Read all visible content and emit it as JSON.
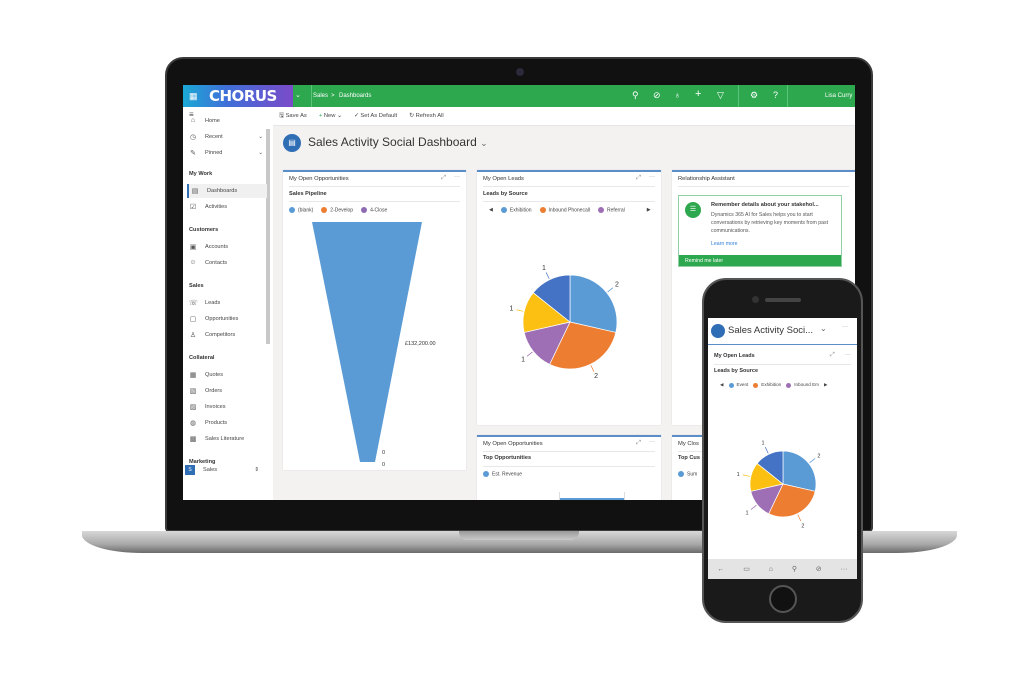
{
  "brand": {
    "logo": "CHORUS",
    "green": "#2ea84f",
    "accent": "#2f6db5"
  },
  "topbar": {
    "breadcrumb": [
      "Sales",
      "Dashboards"
    ],
    "separator": ">",
    "user": "Lisa Curry",
    "icons": [
      "search-icon",
      "task-icon",
      "lightbulb-icon",
      "plus-icon",
      "filter-icon",
      "gear-icon",
      "help-icon"
    ]
  },
  "sidebar": {
    "top": [
      {
        "label": "Home",
        "icon": "⌂"
      },
      {
        "label": "Recent",
        "icon": "◷"
      },
      {
        "label": "Pinned",
        "icon": "✎"
      }
    ],
    "sections": [
      {
        "title": "My Work",
        "items": [
          {
            "label": "Dashboards",
            "icon": "▤",
            "active": true
          },
          {
            "label": "Activities",
            "icon": "☑"
          }
        ]
      },
      {
        "title": "Customers",
        "items": [
          {
            "label": "Accounts",
            "icon": "▣"
          },
          {
            "label": "Contacts",
            "icon": "☺"
          }
        ]
      },
      {
        "title": "Sales",
        "items": [
          {
            "label": "Leads",
            "icon": "☏"
          },
          {
            "label": "Opportunities",
            "icon": "▢"
          },
          {
            "label": "Competitors",
            "icon": "♙"
          }
        ]
      },
      {
        "title": "Collateral",
        "items": [
          {
            "label": "Quotes",
            "icon": "▦"
          },
          {
            "label": "Orders",
            "icon": "▧"
          },
          {
            "label": "Invoices",
            "icon": "▨"
          },
          {
            "label": "Products",
            "icon": "◍"
          },
          {
            "label": "Sales Literature",
            "icon": "▩"
          }
        ]
      },
      {
        "title": "Marketing",
        "items": []
      }
    ],
    "area": {
      "badge": "S",
      "label": "Sales"
    }
  },
  "commands": {
    "save_as": "Save As",
    "new": "New",
    "set_default": "Set As Default",
    "refresh": "Refresh All"
  },
  "dashboard_title": "Sales Activity Social Dashboard",
  "cards": {
    "opps": {
      "title": "My Open Opportunities",
      "subtitle": "Sales Pipeline",
      "legend": [
        {
          "label": "(blank)",
          "color": "#5b9bd5"
        },
        {
          "label": "2-Develop",
          "color": "#ed7d31"
        },
        {
          "label": "4-Close",
          "color": "#8e6bb0"
        }
      ]
    },
    "leads": {
      "title": "My Open Leads",
      "subtitle": "Leads by Source",
      "legend": [
        {
          "label": "Exhibition",
          "color": "#5b9bd5"
        },
        {
          "label": "Inbound Phonecall",
          "color": "#ed7d31"
        },
        {
          "label": "Referral",
          "color": "#9e6fb4"
        }
      ]
    },
    "assistant": {
      "title": "Relationship Assistant",
      "heading": "Remember details about your stakehol...",
      "body": "Dynamics 365 AI for Sales helps you to start conversations by retrieving key moments from past communications.",
      "link": "Learn more",
      "action": "Remind me later"
    },
    "top_opps": {
      "title": "My Open Opportunities",
      "subtitle": "Top Opportunities",
      "legend": [
        {
          "label": "Est. Revenue",
          "color": "#5b9bd5"
        }
      ]
    },
    "closed": {
      "title": "My Clos",
      "subtitle": "Top Cus",
      "legend": [
        {
          "label": "Sum",
          "color": "#5b9bd5"
        }
      ]
    }
  },
  "chart_data": [
    {
      "type": "funnel",
      "title": "Sales Pipeline",
      "categories": [
        "(blank)",
        "2-Develop",
        "4-Close"
      ],
      "values": [
        132200,
        0,
        0
      ],
      "labels": [
        "£132,200.00",
        "0",
        "0"
      ]
    },
    {
      "type": "pie",
      "title": "Leads by Source",
      "values": [
        2,
        2,
        1,
        1,
        1
      ],
      "colors": [
        "#5b9bd5",
        "#ed7d31",
        "#9e6fb4",
        "#fcc012",
        "#4472c4"
      ],
      "labels": [
        "2",
        "2",
        "1",
        "1",
        "1"
      ]
    }
  ],
  "phone": {
    "title": "Sales Activity Soci...",
    "card_title": "My Open Leads",
    "subtitle": "Leads by Source",
    "legend": [
      {
        "label": "Event",
        "color": "#5b9bd5"
      },
      {
        "label": "Exhibition",
        "color": "#ed7d31"
      },
      {
        "label": "Inbound Em",
        "color": "#9e6fb4"
      }
    ],
    "nav_icons": [
      "back-icon",
      "menu-icon",
      "home-icon",
      "search-icon",
      "task-icon",
      "more-icon"
    ]
  }
}
